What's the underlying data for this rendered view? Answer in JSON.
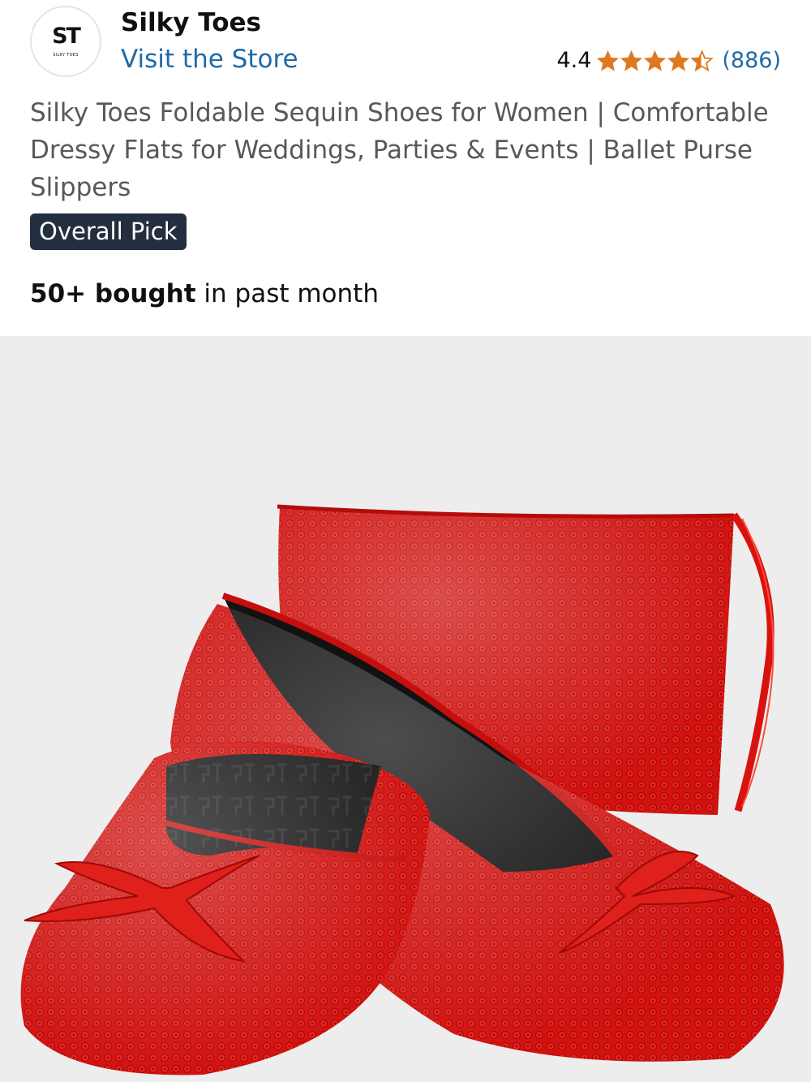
{
  "header": {
    "logo_text": "ST",
    "logo_subtext": "SILKY TOES",
    "brand_name": "Silky Toes",
    "visit_store_label": "Visit the Store",
    "rating_value": "4.4",
    "rating_stars": 4.4,
    "review_count": "(886)",
    "star_color": "#de7921"
  },
  "product": {
    "title": "Silky Toes Foldable Sequin Shoes for Women | Comfortable Dressy Flats for Weddings, Parties & Events | Ballet Purse Slippers",
    "badge": "Overall Pick",
    "bought_strong": "50+ bought",
    "bought_rest": " in past month",
    "image": {
      "icon": "product-photo",
      "description_colors": {
        "sequin_red": "#d8130f",
        "background": "#ededed"
      }
    }
  },
  "colors": {
    "link": "#1f6aa8",
    "badge_bg": "#232f3e",
    "title_text": "#565959"
  }
}
